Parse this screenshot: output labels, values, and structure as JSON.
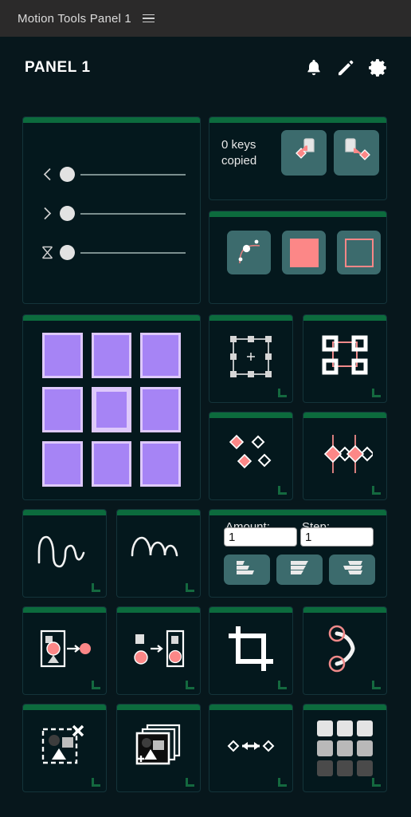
{
  "window": {
    "title": "Motion Tools Panel 1",
    "menu_icon": "hamburger-icon"
  },
  "header": {
    "title": "PANEL 1",
    "icons": [
      {
        "name": "bell-icon",
        "label": "Notifications"
      },
      {
        "name": "pencil-icon",
        "label": "Edit"
      },
      {
        "name": "gear-icon",
        "label": "Settings"
      }
    ]
  },
  "theme": {
    "background": "#07171c",
    "titlebar": "#2b2a2a",
    "card_bg": "#04181d",
    "accent_green": "#0c6b3d",
    "teal_button": "#3c6b6d",
    "keyframe_red": "#fc8787",
    "anchor_purple": "#a684f5",
    "anchor_border": "#dec9fb",
    "text": "#e8e8e8"
  },
  "sliders": {
    "rows": [
      {
        "name": "ease-in-slider",
        "icon": "chevron-left-icon",
        "value": 0
      },
      {
        "name": "ease-out-slider",
        "icon": "chevron-right-icon",
        "value": 0
      },
      {
        "name": "ease-both-slider",
        "icon": "hourglass-icon",
        "value": 0
      }
    ]
  },
  "copy_panel": {
    "status": "0 keys",
    "status_line2": "copied",
    "buttons": [
      {
        "name": "copy-keys-button",
        "icon": "copy-keyframes-icon"
      },
      {
        "name": "paste-keys-button",
        "icon": "paste-keyframes-icon"
      }
    ]
  },
  "style_panel": {
    "buttons": [
      {
        "name": "bezier-curve-button",
        "icon": "bezier-curve-icon"
      },
      {
        "name": "fill-color-button",
        "icon": "filled-square-icon",
        "color": "#fc8787"
      },
      {
        "name": "stroke-color-button",
        "icon": "outline-square-icon",
        "color": "#fc8787"
      }
    ]
  },
  "anchor_grid": {
    "name": "anchor-point-grid",
    "cells": [
      "anchor-top-left",
      "anchor-top-center",
      "anchor-top-right",
      "anchor-middle-left",
      "anchor-center",
      "anchor-middle-right",
      "anchor-bottom-left",
      "anchor-bottom-center",
      "anchor-bottom-right"
    ],
    "selected": "anchor-center"
  },
  "stagger_panel": {
    "amount": {
      "label": "Amount:",
      "value": "1",
      "placeholder": "1"
    },
    "step": {
      "label": "Step:",
      "value": "1",
      "placeholder": "1"
    },
    "buttons": [
      {
        "name": "stagger-left-button",
        "icon": "align-left-stagger-icon"
      },
      {
        "name": "stagger-center-button",
        "icon": "align-center-stagger-icon"
      },
      {
        "name": "stagger-right-button",
        "icon": "align-right-stagger-icon"
      }
    ]
  },
  "tools": [
    {
      "name": "bounding-box-tool",
      "icon": "bounding-box-icon"
    },
    {
      "name": "distribute-tool",
      "icon": "distribute-squares-icon"
    },
    {
      "name": "select-keyframes-tool",
      "icon": "scattered-diamonds-icon"
    },
    {
      "name": "align-keyframes-tool",
      "icon": "diamonds-on-playhead-icon"
    },
    {
      "name": "oscillate-tool",
      "icon": "wave-oscillation-icon"
    },
    {
      "name": "bounce-tool",
      "icon": "bounce-curve-icon"
    },
    {
      "name": "extract-layer-tool",
      "icon": "extract-from-group-icon"
    },
    {
      "name": "group-layer-tool",
      "icon": "group-into-container-icon"
    },
    {
      "name": "crop-tool",
      "icon": "crop-icon"
    },
    {
      "name": "path-anchor-tool",
      "icon": "path-with-anchors-icon"
    },
    {
      "name": "delete-selection-tool",
      "icon": "delete-selection-icon"
    },
    {
      "name": "duplicate-layers-tool",
      "icon": "duplicate-layers-icon"
    },
    {
      "name": "keyframe-spacing-tool",
      "icon": "keyframe-spacing-icon"
    },
    {
      "name": "opacity-grid-tool",
      "icon": "opacity-shade-grid-icon"
    }
  ]
}
